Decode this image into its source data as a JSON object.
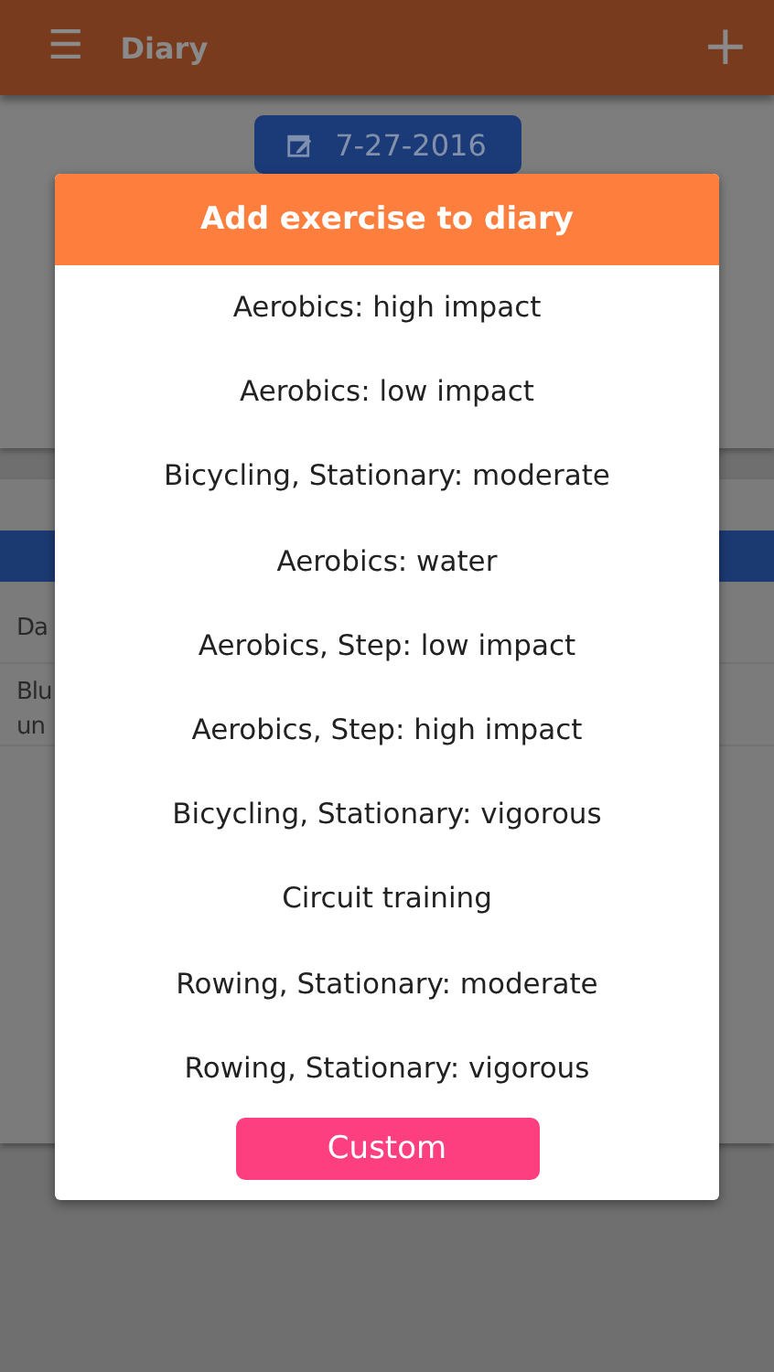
{
  "app_bar": {
    "menu_icon": "☰",
    "title": "Diary",
    "add_icon": "+"
  },
  "date_button": {
    "label": "7-27-2016"
  },
  "list_rows": [
    {
      "text": "Da"
    },
    {
      "text": "Blu\nun"
    }
  ],
  "dialog": {
    "title": "Add exercise to diary",
    "items": [
      "Aerobics: high impact",
      "Aerobics: low impact",
      "Bicycling, Stationary: moderate",
      "Aerobics: water",
      "Aerobics, Step: low impact",
      "Aerobics, Step: high impact",
      "Bicycling, Stationary: vigorous",
      "Circuit training",
      "Rowing, Stationary: moderate",
      "Rowing, Stationary: vigorous"
    ],
    "button": "Custom"
  }
}
